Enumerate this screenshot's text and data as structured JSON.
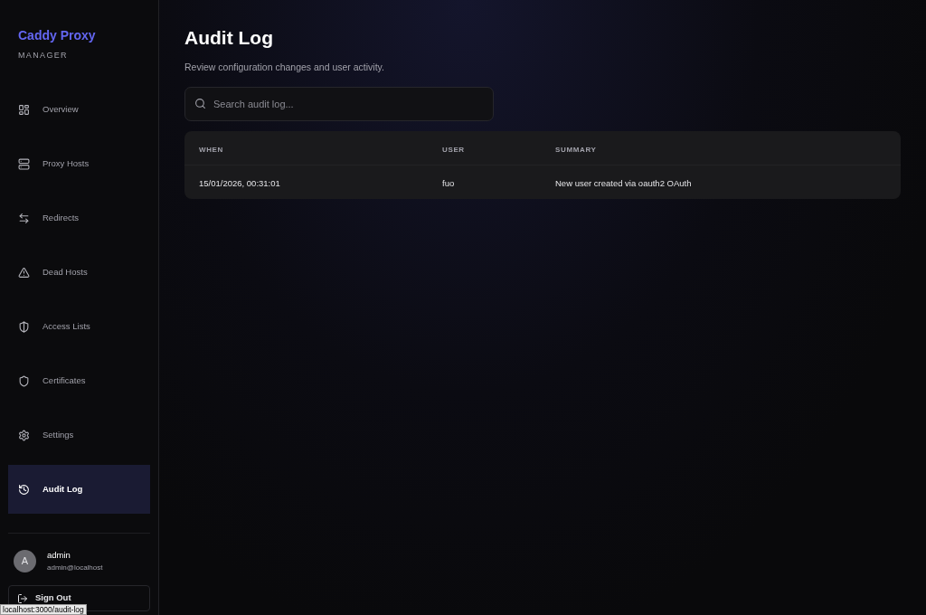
{
  "brand": {
    "title": "Caddy Proxy",
    "subtitle": "MANAGER"
  },
  "nav": [
    {
      "label": "Overview",
      "selected": false
    },
    {
      "label": "Proxy Hosts",
      "selected": false
    },
    {
      "label": "Redirects",
      "selected": false
    },
    {
      "label": "Dead Hosts",
      "selected": false
    },
    {
      "label": "Access Lists",
      "selected": false
    },
    {
      "label": "Certificates",
      "selected": false
    },
    {
      "label": "Settings",
      "selected": false
    },
    {
      "label": "Audit Log",
      "selected": true
    }
  ],
  "user": {
    "avatar": "A",
    "name": "admin",
    "email": "admin@localhost"
  },
  "sign_out": "Sign Out",
  "page": {
    "title": "Audit Log",
    "subtitle": "Review configuration changes and user activity."
  },
  "search": {
    "placeholder": "Search audit log..."
  },
  "table": {
    "columns": [
      "WHEN",
      "USER",
      "SUMMARY"
    ],
    "rows": [
      [
        "15/01/2026, 00:31:01",
        "fuo",
        "New user created via oauth2 OAuth"
      ]
    ]
  },
  "status_url": "localhost:3000/audit-log"
}
